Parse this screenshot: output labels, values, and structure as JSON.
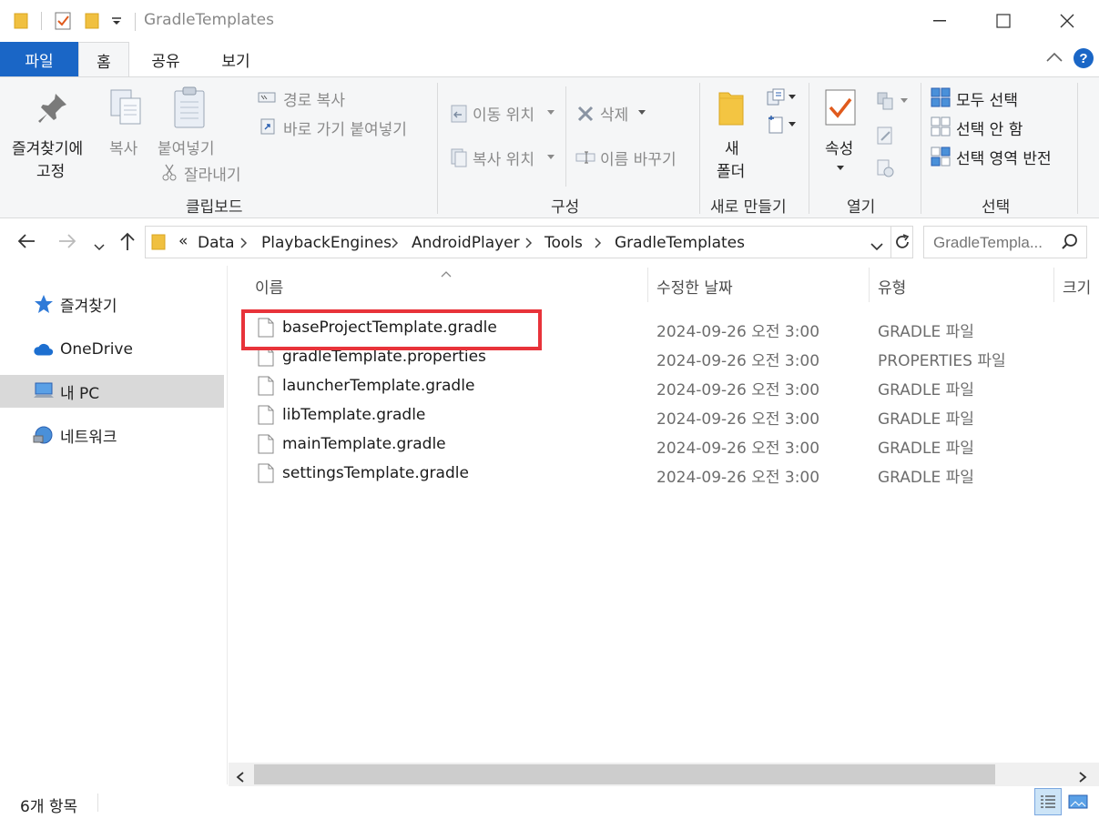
{
  "window": {
    "title": "GradleTemplates"
  },
  "ribbon_tabs": [
    "파일",
    "홈",
    "공유",
    "보기"
  ],
  "ribbon": {
    "clipboard": {
      "pin_label_1": "즐겨찾기에",
      "pin_label_2": "고정",
      "copy": "복사",
      "paste": "붙여넣기",
      "copy_path": "경로 복사",
      "paste_shortcut": "바로 가기 붙여넣기",
      "cut": "잘라내기",
      "group": "클립보드"
    },
    "organize": {
      "move_to": "이동 위치",
      "copy_to": "복사 위치",
      "delete": "삭제",
      "rename": "이름 바꾸기",
      "group": "구성"
    },
    "new": {
      "new_folder_1": "새",
      "new_folder_2": "폴더",
      "group": "새로 만들기"
    },
    "open": {
      "properties": "속성",
      "group": "열기"
    },
    "select": {
      "select_all": "모두 선택",
      "select_none": "선택 안 함",
      "invert": "선택 영역 반전",
      "group": "선택"
    }
  },
  "address": {
    "overflow": "«",
    "crumbs": [
      "Data",
      "PlaybackEngines",
      "AndroidPlayer",
      "Tools",
      "GradleTemplates"
    ],
    "search_placeholder": "GradleTempla..."
  },
  "nav": {
    "items": [
      "즐겨찾기",
      "OneDrive",
      "내 PC",
      "네트워크"
    ],
    "selected": "내 PC"
  },
  "columns": [
    "이름",
    "수정한 날짜",
    "유형",
    "크기"
  ],
  "files": [
    {
      "name": "baseProjectTemplate.gradle",
      "date": "2024-09-26 오전 3:00",
      "type": "GRADLE 파일"
    },
    {
      "name": "gradleTemplate.properties",
      "date": "2024-09-26 오전 3:00",
      "type": "PROPERTIES 파일"
    },
    {
      "name": "launcherTemplate.gradle",
      "date": "2024-09-26 오전 3:00",
      "type": "GRADLE 파일"
    },
    {
      "name": "libTemplate.gradle",
      "date": "2024-09-26 오전 3:00",
      "type": "GRADLE 파일"
    },
    {
      "name": "mainTemplate.gradle",
      "date": "2024-09-26 오전 3:00",
      "type": "GRADLE 파일"
    },
    {
      "name": "settingsTemplate.gradle",
      "date": "2024-09-26 오전 3:00",
      "type": "GRADLE 파일"
    }
  ],
  "status": {
    "item_count": "6개 항목"
  },
  "colors": {
    "accent": "#1a66c6",
    "highlight": "#e8333a",
    "folder": "#f0c040"
  }
}
